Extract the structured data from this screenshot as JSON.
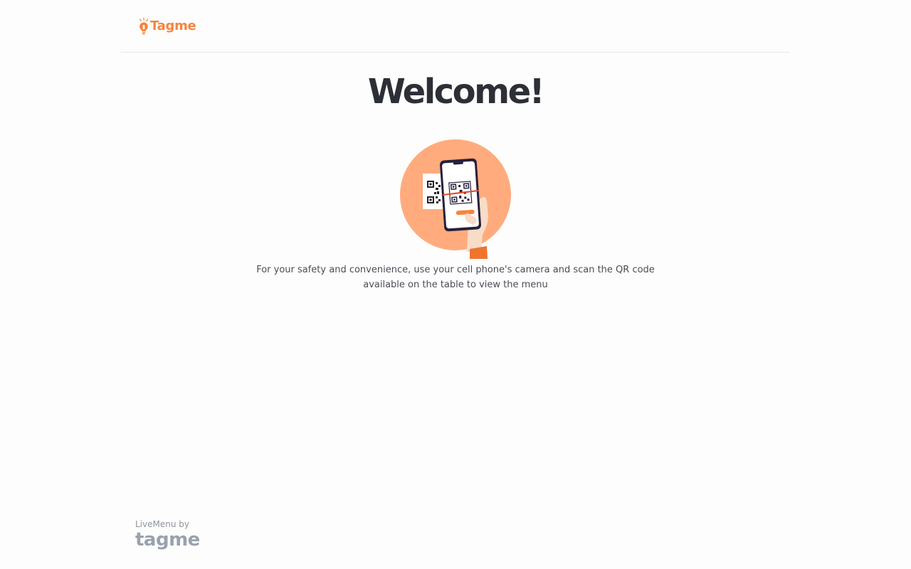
{
  "header": {
    "logo_text": "Tagme",
    "logo_icon": "lightbulb-icon",
    "brand_color": "#f5853f"
  },
  "main": {
    "title": "Welcome!",
    "illustration": "qr-scan-phone-illustration",
    "message": "For your safety and convenience, use your cell phone's camera and scan the QR code available on the table to view the menu"
  },
  "footer": {
    "label": "LiveMenu by",
    "brand": "tagme"
  }
}
